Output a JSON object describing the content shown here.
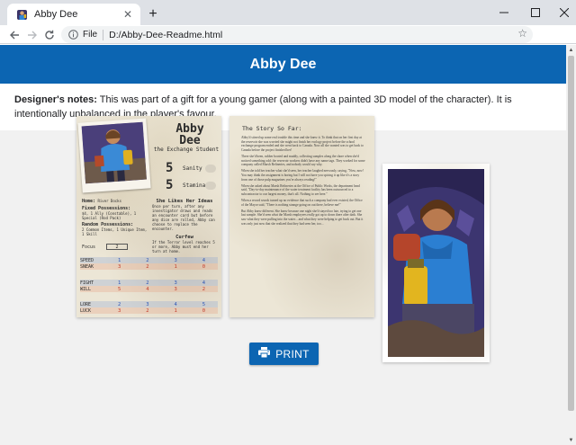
{
  "browser": {
    "tab_title": "Abby Dee",
    "new_tab_symbol": "+",
    "address_label": "File",
    "url": "D:/Abby-Dee-Readme.html"
  },
  "page": {
    "title": "Abby Dee",
    "notes_label": "Designer's notes:",
    "notes_text": " This was part of a gift for a young gamer (along with a painted 3D model of the character). It is intentionally unbalanced in the player's favour.",
    "print_label": "PRINT"
  },
  "card_front": {
    "name_line1": "Abby",
    "name_line2": "Dee",
    "role": "the Exchange Student",
    "sanity_value": "5",
    "sanity_label": "Sanity",
    "stamina_value": "5",
    "stamina_label": "Stamina",
    "home_label": "Home:",
    "home_value": "River Docks",
    "fixed_label": "Fixed Possessions:",
    "fixed_value": "$4, 1 Ally (Constable), 1 Special (Rod Pack)",
    "random_label": "Random Possessions:",
    "random_value": "2 Common Items, 1 Unique Item, 1 Skill",
    "ability_title": "She Likes Her Ideas",
    "ability_text": "Once per turn, after any investigator draws and reads an encounter card but before any dice are rolled, Abby can choose to replace the encounter.",
    "curfew_title": "Curfew",
    "curfew_text": "If the Terror level reaches 5 or more, Abby must end her turn at home.",
    "focus_label": "Focus",
    "focus_value": "2",
    "skills": [
      {
        "name": "SPEED",
        "values": [
          "1",
          "2",
          "3",
          "4"
        ],
        "color": "blue"
      },
      {
        "name": "SNEAK",
        "values": [
          "3",
          "2",
          "1",
          "0"
        ],
        "color": "red"
      },
      {
        "name": "FIGHT",
        "values": [
          "1",
          "2",
          "3",
          "4"
        ],
        "color": "blue"
      },
      {
        "name": "WILL",
        "values": [
          "5",
          "4",
          "3",
          "2"
        ],
        "color": "red"
      },
      {
        "name": "LORE",
        "values": [
          "2",
          "3",
          "4",
          "5"
        ],
        "color": "blue"
      },
      {
        "name": "LUCK",
        "values": [
          "3",
          "2",
          "1",
          "0"
        ],
        "color": "red"
      }
    ]
  },
  "card_story": {
    "title": "The Story So Far:",
    "paragraphs": [
      "Abby'd stirred up some real trouble this time and she knew it. To think that on her first day at the reservoir she was worried she might not finish her ecology project before the school exchange program ended and she went back to Canada. Now all she wanted was to get back to Canada before the project finished her!",
      "There she'd been, rubber booted and muddy, collecting samples along the shore when she'd noticed something odd: the reservoir workers didn't have any name tags. They worked for some company called Marsh Refineries, and nobody would say why.",
      "When she told her teacher what she'd seen, her teacher laughed nervously, saying, \"Now, now! You may think the assignment is boring but I will not have you spicing it up like it's a story from one of those pulp magazines you're always reading!\"",
      "When she asked about Marsh Refineries at the Office of Public Works, the department head said, \"Day-to-day maintenance of the water treatment facility has been outsourced to a subcontractor to our largest money, that's all. Nothing to see here.\"",
      "When a record search turned up no evidence that such a company had ever existed, the Office of the Mayor said, \"There is nothing strange going on out there, believe me!\"",
      "But Abby knew different. She knew because one night she'd stayed too late, trying to get one last sample. She'd seen what the Marsh employees really got up to down there after dark. She saw what they were pulling into the water... and what they were helping to get back out. But it was only just now that she realized that they had seen her, too..."
    ]
  },
  "colors": {
    "header_blue": "#0c65b2",
    "stat_blue": "#2c55b5",
    "stat_red": "#c23a2a"
  },
  "icons": {
    "favicon": "abby-favicon-icon",
    "print": "printer-icon"
  }
}
